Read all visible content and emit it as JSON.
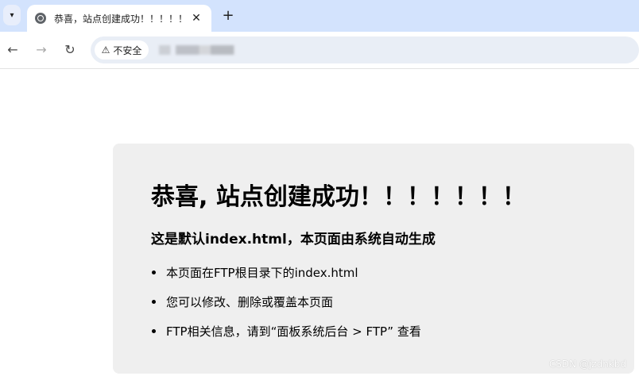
{
  "browser": {
    "tab": {
      "title": "恭喜，站点创建成功！！！！！"
    },
    "security_label": "不安全"
  },
  "page": {
    "title": "恭喜, 站点创建成功！！！！！！！",
    "subtitle": "这是默认index.html，本页面由系统自动生成",
    "items": [
      "本页面在FTP根目录下的index.html",
      "您可以修改、删除或覆盖本页面",
      "FTP相关信息，请到“面板系统后台 > FTP” 查看"
    ]
  },
  "watermark": "CSDN @jzdnkbd"
}
